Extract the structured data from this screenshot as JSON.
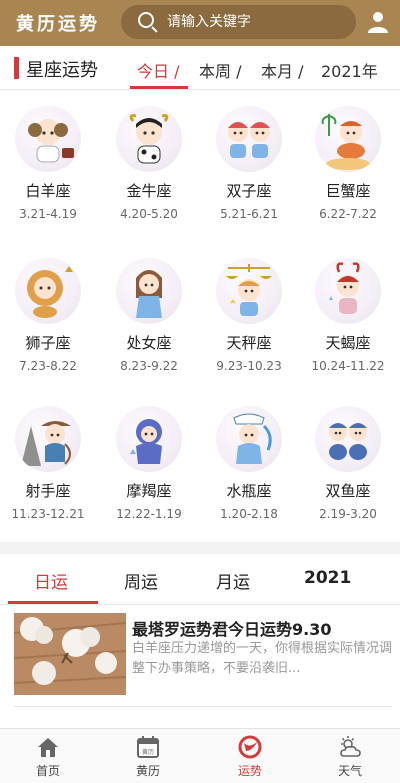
{
  "header": {
    "logo": "黄历运势",
    "search_placeholder": "请输入关键字",
    "colors": {
      "bar": "#a98552",
      "search_bg": "#8a6a3e"
    }
  },
  "section": {
    "title": "星座运势",
    "range_tabs": [
      {
        "label": "今日 /",
        "active": true
      },
      {
        "label": "本周 /",
        "active": false
      },
      {
        "label": "本月 /",
        "active": false
      },
      {
        "label": "2021年",
        "active": false
      }
    ]
  },
  "zodiac": [
    {
      "name": "白羊座",
      "dates": "3.21-4.19"
    },
    {
      "name": "金牛座",
      "dates": "4.20-5.20"
    },
    {
      "name": "双子座",
      "dates": "5.21-6.21"
    },
    {
      "name": "巨蟹座",
      "dates": "6.22-7.22"
    },
    {
      "name": "狮子座",
      "dates": "7.23-8.22"
    },
    {
      "name": "处女座",
      "dates": "8.23-9.22"
    },
    {
      "name": "天秤座",
      "dates": "9.23-10.23"
    },
    {
      "name": "天蝎座",
      "dates": "10.24-11.22"
    },
    {
      "name": "射手座",
      "dates": "11.23-12.21"
    },
    {
      "name": "摩羯座",
      "dates": "12.22-1.19"
    },
    {
      "name": "水瓶座",
      "dates": "1.20-2.18"
    },
    {
      "name": "双鱼座",
      "dates": "2.19-3.20"
    }
  ],
  "fortune_tabs": [
    {
      "label": "日运",
      "active": true
    },
    {
      "label": "周运",
      "active": false
    },
    {
      "label": "月运",
      "active": false
    },
    {
      "label": "2021",
      "active": false
    }
  ],
  "article": {
    "title": "最塔罗运势君今日运势9.30",
    "summary": "白羊座压力递增的一天，你得根据实际情况调整下办事策略，不要沿袭旧..."
  },
  "bottom_nav": [
    {
      "label": "首页",
      "icon": "home-icon",
      "active": false
    },
    {
      "label": "黄历",
      "icon": "calendar-icon",
      "active": false,
      "icon_text": "黄历"
    },
    {
      "label": "运势",
      "icon": "fortune-icon",
      "active": true
    },
    {
      "label": "天气",
      "icon": "weather-icon",
      "active": false
    }
  ],
  "accent_color": "#d33a3a"
}
